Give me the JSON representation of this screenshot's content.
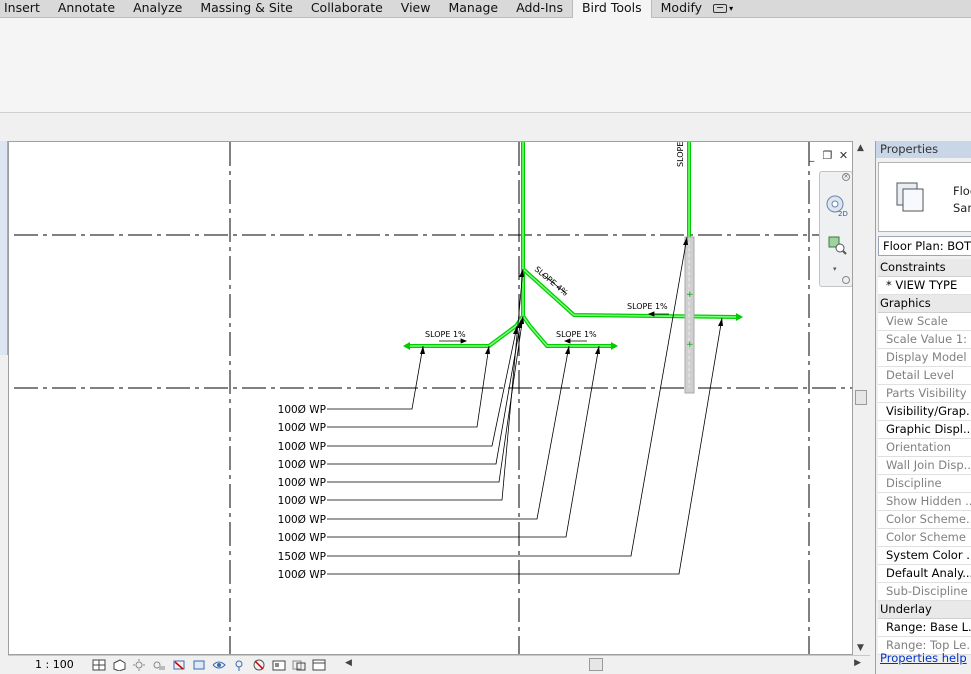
{
  "ribbon": {
    "tabs": [
      {
        "label": "Insert"
      },
      {
        "label": "Annotate"
      },
      {
        "label": "Analyze"
      },
      {
        "label": "Massing & Site"
      },
      {
        "label": "Collaborate"
      },
      {
        "label": "View"
      },
      {
        "label": "Manage"
      },
      {
        "label": "Add-Ins"
      },
      {
        "label": "Bird Tools",
        "active": true
      },
      {
        "label": "Modify"
      }
    ],
    "extra_icon": "panel-toggle-icon"
  },
  "drawing": {
    "slope_labels": [
      "SLOPE",
      "SLOPE 4%",
      "SLOPE 1%",
      "SLOPE 1%",
      "SLOPE 1%"
    ],
    "pipe_tags": [
      "100Ø WP",
      "100Ø WP",
      "100Ø WP",
      "100Ø WP",
      "100Ø WP",
      "100Ø WP",
      "100Ø WP",
      "100Ø WP",
      "150Ø WP",
      "100Ø WP"
    ],
    "pipe_color": "#00cc00",
    "pipe_highlight": "#7cff7c"
  },
  "statusbar": {
    "scale": "1 : 100",
    "icons": [
      "detail-level-icon",
      "visual-style-icon",
      "sun-path-icon",
      "shadows-icon",
      "crop-view-icon",
      "crop-region-icon",
      "temporary-hide-icon",
      "reveal-hidden-icon",
      "worksharing-icon",
      "analytical-model-icon",
      "highlight-displacement-icon",
      "constraints-icon"
    ]
  },
  "properties": {
    "title": "Properties",
    "type_line1": "Floo",
    "type_line2": "Sani",
    "view_selector": "Floor Plan: BOTTO",
    "rows": [
      {
        "label": "Constraints",
        "kind": "section"
      },
      {
        "label": "* VIEW TYPE",
        "kind": "black"
      },
      {
        "label": "Graphics",
        "kind": "section"
      },
      {
        "label": "View Scale",
        "kind": "grey"
      },
      {
        "label": "Scale Value    1:",
        "kind": "grey"
      },
      {
        "label": "Display Model",
        "kind": "grey"
      },
      {
        "label": "Detail Level",
        "kind": "grey"
      },
      {
        "label": "Parts Visibility",
        "kind": "grey"
      },
      {
        "label": "Visibility/Grap...",
        "kind": "black"
      },
      {
        "label": "Graphic Displ...",
        "kind": "black"
      },
      {
        "label": "Orientation",
        "kind": "grey"
      },
      {
        "label": "Wall Join Disp...",
        "kind": "grey"
      },
      {
        "label": "Discipline",
        "kind": "grey"
      },
      {
        "label": "Show Hidden ...",
        "kind": "grey"
      },
      {
        "label": "Color Scheme...",
        "kind": "grey"
      },
      {
        "label": "Color Scheme",
        "kind": "grey"
      },
      {
        "label": "System Color ...",
        "kind": "black"
      },
      {
        "label": "Default Analy...",
        "kind": "black"
      },
      {
        "label": "Sub-Discipline",
        "kind": "grey"
      },
      {
        "label": "Underlay",
        "kind": "section"
      },
      {
        "label": "Range: Base L...",
        "kind": "black"
      },
      {
        "label": "Range: Top Le...",
        "kind": "grey"
      }
    ],
    "help_link": "Properties help"
  }
}
